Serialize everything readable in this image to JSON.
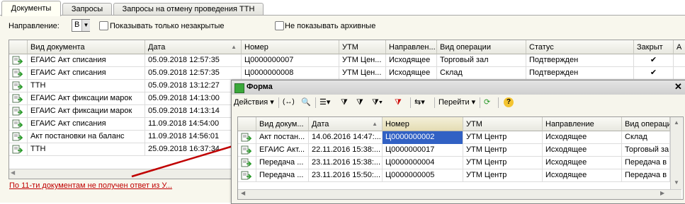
{
  "tabs": [
    "Документы",
    "Запросы",
    "Запросы на отмену проведения ТТН"
  ],
  "filters": {
    "direction_label": "Направление:",
    "direction_value": "В",
    "only_open_label": "Показывать только незакрытые",
    "no_archive_label": "Не показывать архивные"
  },
  "main_table": {
    "columns": [
      "Вид документа",
      "Дата",
      "Номер",
      "УТМ",
      "Направлен...",
      "Вид операции",
      "Статус",
      "Закрыт",
      "А"
    ],
    "rows": [
      {
        "type": "ЕГАИС Акт списания",
        "date": "05.09.2018 12:57:35",
        "number": "Ц0000000007",
        "utm": "УТМ Цен...",
        "direction": "Исходящее",
        "operation": "Торговый зал",
        "status": "Подтвержден",
        "closed": "✔"
      },
      {
        "type": "ЕГАИС Акт списания",
        "date": "05.09.2018 12:57:35",
        "number": "Ц0000000008",
        "utm": "УТМ Цен...",
        "direction": "Исходящее",
        "operation": "Склад",
        "status": "Подтвержден",
        "closed": "✔"
      },
      {
        "type": "ТТН",
        "date": "05.09.2018 13:12:27",
        "number": "",
        "utm": "",
        "direction": "",
        "operation": "",
        "status": "",
        "closed": ""
      },
      {
        "type": "ЕГАИС Акт фиксации марок",
        "date": "05.09.2018 14:13:00",
        "number": "",
        "utm": "",
        "direction": "",
        "operation": "",
        "status": "",
        "closed": ""
      },
      {
        "type": "ЕГАИС Акт фиксации марок",
        "date": "05.09.2018 14:13:14",
        "number": "",
        "utm": "",
        "direction": "",
        "operation": "",
        "status": "",
        "closed": ""
      },
      {
        "type": "ЕГАИС Акт списания",
        "date": "11.09.2018 14:54:00",
        "number": "",
        "utm": "",
        "direction": "",
        "operation": "",
        "status": "",
        "closed": ""
      },
      {
        "type": "Акт постановки на баланс",
        "date": "11.09.2018 14:56:01",
        "number": "",
        "utm": "",
        "direction": "",
        "operation": "",
        "status": "",
        "closed": ""
      },
      {
        "type": "ТТН",
        "date": "25.09.2018 16:37:34",
        "number": "",
        "utm": "",
        "direction": "",
        "operation": "",
        "status": "",
        "closed": ""
      }
    ]
  },
  "warning_link": "По 11-ти документам не получен ответ из У...",
  "popup": {
    "title": "Форма",
    "toolbar": {
      "actions": "Действия",
      "goto": "Перейти"
    },
    "columns": [
      "Вид докум...",
      "Дата",
      "Номер",
      "УТМ",
      "Направление",
      "Вид операци"
    ],
    "rows": [
      {
        "type": "Акт постан...",
        "date": "14.06.2016 14:47:...",
        "number": "Ц0000000002",
        "utm": "УТМ Центр",
        "direction": "Исходящее",
        "operation": "Склад"
      },
      {
        "type": "ЕГАИС Акт...",
        "date": "22.11.2016 15:38:...",
        "number": "Ц0000000017",
        "utm": "УТМ Центр",
        "direction": "Исходящее",
        "operation": "Торговый за"
      },
      {
        "type": "Передача ...",
        "date": "23.11.2016 15:38:...",
        "number": "Ц0000000004",
        "utm": "УТМ Центр",
        "direction": "Исходящее",
        "operation": "Передача в"
      },
      {
        "type": "Передача ...",
        "date": "23.11.2016 15:50:...",
        "number": "Ц0000000005",
        "utm": "УТМ Центр",
        "direction": "Исходящее",
        "operation": "Передача в"
      }
    ]
  },
  "colors": {
    "selection": "#3161c4",
    "link": "#c00000",
    "arrow": "#c00000"
  }
}
